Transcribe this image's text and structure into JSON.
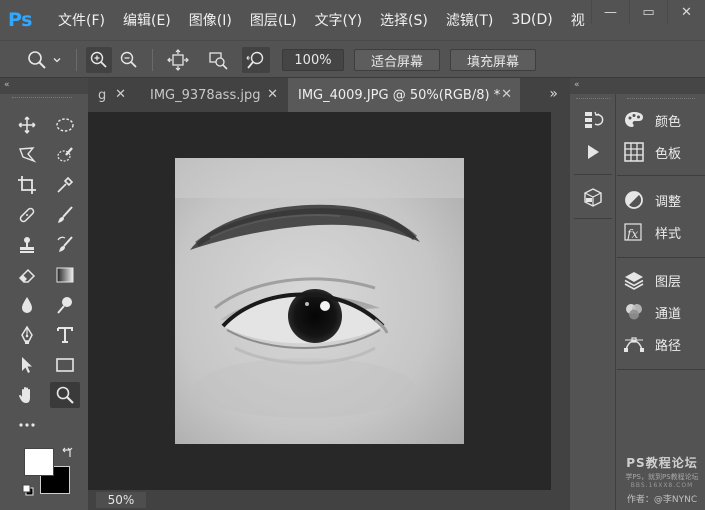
{
  "app": {
    "logo": "Ps"
  },
  "menu": [
    "文件(F)",
    "编辑(E)",
    "图像(I)",
    "图层(L)",
    "文字(Y)",
    "选择(S)",
    "滤镜(T)",
    "3D(D)",
    "视"
  ],
  "window_controls": {
    "minimize": "—",
    "restore": "▭",
    "close": "✕"
  },
  "options": {
    "zoom_level": "100%",
    "fit_screen_label": "适合屏幕",
    "fill_screen_label": "填充屏幕"
  },
  "tabs": [
    {
      "label": "g",
      "close": "✕"
    },
    {
      "label": "IMG_9378ass.jpg",
      "close": "✕"
    },
    {
      "label": "IMG_4009.JPG @ 50%(RGB/8) *",
      "close": "✕",
      "active": true
    }
  ],
  "tab_overflow": "»",
  "status": {
    "zoom": "50%"
  },
  "panels": [
    {
      "label": "颜色",
      "icon": "palette-icon"
    },
    {
      "label": "色板",
      "icon": "swatches-grid-icon"
    },
    {
      "label": "调整",
      "icon": "adjustment-circle-icon"
    },
    {
      "label": "样式",
      "icon": "fx-style-icon"
    },
    {
      "label": "图层",
      "icon": "layers-stack-icon"
    },
    {
      "label": "通道",
      "icon": "channels-icon"
    },
    {
      "label": "路径",
      "icon": "pen-path-icon"
    }
  ],
  "watermark": {
    "title": "PS教程论坛",
    "subtitle": "学PS，就到PS教程论坛",
    "url": "BBS.16XX8.COM",
    "author": "作者：@李NYNC"
  },
  "colors": {
    "foreground": "#ffffff",
    "background": "#000000",
    "accent": "#31a8ff"
  }
}
